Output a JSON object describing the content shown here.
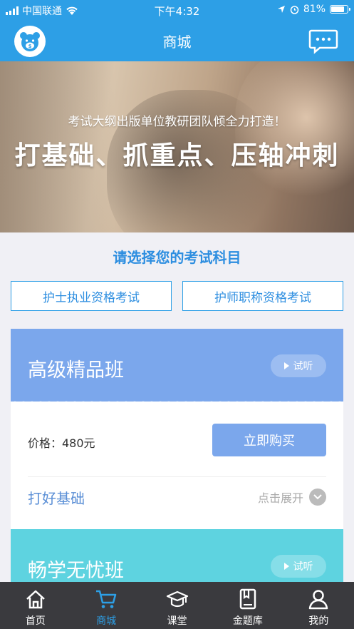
{
  "status": {
    "carrier": "中国联通",
    "time": "下午4:32",
    "battery": "81%",
    "battery_level": 0.81
  },
  "nav": {
    "title": "商城",
    "logo_icon": "bear-logo-icon",
    "chat_icon": "chat-bubble-icon"
  },
  "banner": {
    "subtitle": "考试大纲出版单位教研团队倾全力打造！",
    "headline": "打基础、抓重点、压轴冲刺"
  },
  "section": {
    "title": "请选择您的考试科目"
  },
  "exams": [
    {
      "label": "护士执业资格考试"
    },
    {
      "label": "护师职称资格考试"
    }
  ],
  "courses": [
    {
      "title": "高级精品班",
      "try_label": "试听",
      "price": "价格：480元",
      "buy_label": "立即购买",
      "section": "打好基础",
      "expand": "点击展开",
      "color": "#7ba7ec"
    },
    {
      "title": "畅学无忧班",
      "try_label": "试听",
      "color": "#5ed3e0"
    }
  ],
  "tabs": [
    {
      "label": "首页",
      "icon": "home-icon"
    },
    {
      "label": "商城",
      "icon": "cart-icon",
      "active": true
    },
    {
      "label": "课堂",
      "icon": "graduation-cap-icon"
    },
    {
      "label": "金题库",
      "icon": "book-icon"
    },
    {
      "label": "我的",
      "icon": "user-icon"
    }
  ]
}
